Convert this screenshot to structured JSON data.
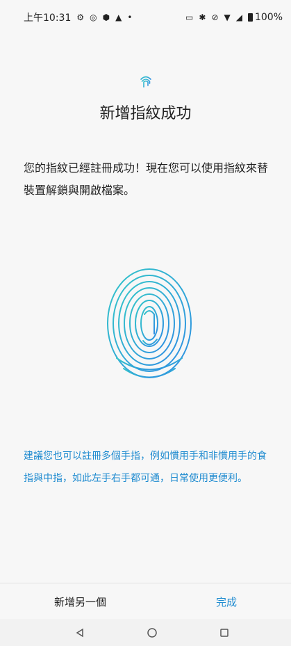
{
  "status_bar": {
    "time": "上午10:31",
    "battery": "100%"
  },
  "icons": {
    "settings": "gear-icon",
    "screen_record": "record-icon",
    "shield": "shield-icon",
    "warning": "warning-icon",
    "dot": "dot-icon",
    "nfc": "nfc-icon",
    "bluetooth": "bluetooth-icon",
    "mute": "mute-icon",
    "wifi": "wifi-icon",
    "signal": "signal-icon",
    "battery": "battery-icon",
    "fingerprint": "fingerprint-icon",
    "back": "back-triangle-icon",
    "home": "home-circle-icon",
    "recents": "recents-square-icon"
  },
  "main": {
    "title": "新增指紋成功",
    "description": "您的指紋已經註冊成功！現在您可以使用指紋來替裝置解鎖與開啟檔案。",
    "tip": "建議您也可以註冊多個手指，例如慣用手和非慣用手的食指與中指，如此左手右手都可通，日常使用更便利。"
  },
  "actions": {
    "add_another": "新增另一個",
    "done": "完成"
  },
  "colors": {
    "accent": "#1f8bd0",
    "fingerprint_start": "#34c6c9",
    "fingerprint_end": "#2f8ee3"
  }
}
